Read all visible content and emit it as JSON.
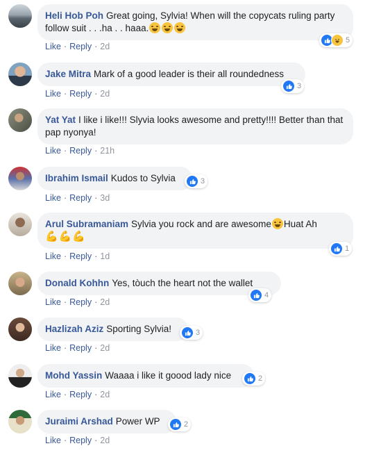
{
  "actions": {
    "like": "Like",
    "reply": "Reply",
    "separator": "·"
  },
  "colors": {
    "author": "#385898",
    "bubble": "#f2f3f5",
    "like_reaction": "#2078f4"
  },
  "comments": [
    {
      "author": "Heli Hob Poh",
      "text": "Great going, Sylvia! When will the copycats ruling party follow suit . . .ha . . haaa.",
      "time": "2d",
      "reaction_count": "5",
      "avatar": "avatar-landscape"
    },
    {
      "author": "Jake Mitra",
      "text": "Mark of a good leader is their all roundedness",
      "time": "2d",
      "reaction_count": "3",
      "avatar": "avatar-person"
    },
    {
      "author": "Yat Yat",
      "text": "I like i like!!! Slyvia looks awesome and pretty!!!! Better than that pap nyonya!",
      "time": "21h",
      "reaction_count": "",
      "avatar": "avatar-person"
    },
    {
      "author": "Ibrahim Ismail",
      "text": "Kudos to Sylvia",
      "time": "3d",
      "reaction_count": "3",
      "avatar": "avatar-person"
    },
    {
      "author": "Arul Subramaniam",
      "text": "Sylvia you rock and are awesome",
      "text2": "Huat Ah",
      "time": "1d",
      "reaction_count": "1",
      "avatar": "avatar-person"
    },
    {
      "author": "Donald Kohhn",
      "text": "Yes, tòuch the heart not the wallet",
      "time": "2d",
      "reaction_count": "4",
      "avatar": "avatar-person"
    },
    {
      "author": "Hazlizah Aziz",
      "text": "Sporting Sylvia!",
      "time": "2d",
      "reaction_count": "3",
      "avatar": "avatar-person"
    },
    {
      "author": "Mohd Yassin",
      "text": "Waaaa i like it goood lady nice",
      "time": "2d",
      "reaction_count": "2",
      "avatar": "avatar-person"
    },
    {
      "author": "Juraimi Arshad",
      "text": "Power WP",
      "time": "2d",
      "reaction_count": "2",
      "avatar": "avatar-person"
    }
  ]
}
